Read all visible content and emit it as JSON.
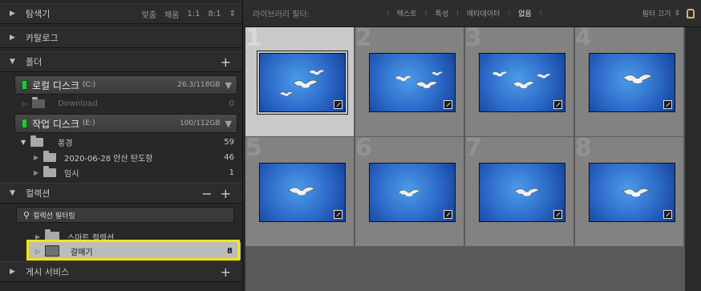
{
  "navigator": {
    "title": "탐색기",
    "options": [
      "맞춤",
      "채움",
      "1:1",
      "8:1"
    ]
  },
  "catalog": {
    "title": "카탈로그"
  },
  "folders": {
    "title": "폴더",
    "volumes": [
      {
        "name": "로컬 디스크",
        "letter": "(C:)",
        "size": "26.3/118GB"
      },
      {
        "name": "작업 디스크",
        "letter": "(E:)",
        "size": "100/112GB"
      }
    ],
    "download": {
      "label": "Download",
      "count": "0"
    },
    "items": [
      {
        "label": "풍경",
        "count": "59"
      },
      {
        "label": "2020-06-28 안산 탄도항",
        "count": "46"
      },
      {
        "label": "임시",
        "count": "1"
      }
    ]
  },
  "collections": {
    "title": "컬렉션",
    "filter": "컬렉션 필터링",
    "smart": "스마트 컬렉션",
    "selected": {
      "label": "갈매기",
      "count": "8"
    }
  },
  "publish": {
    "title": "게시 서비스"
  },
  "library_filter": {
    "label": "라이브러리 필터:",
    "tabs": [
      "텍스트",
      "특성",
      "메타데이터",
      "없음"
    ],
    "active": "없음",
    "filter_off": "필터 끄기"
  },
  "grid": {
    "cells": [
      "1",
      "2",
      "3",
      "4",
      "5",
      "6",
      "7",
      "8"
    ],
    "selected_index": 0
  }
}
